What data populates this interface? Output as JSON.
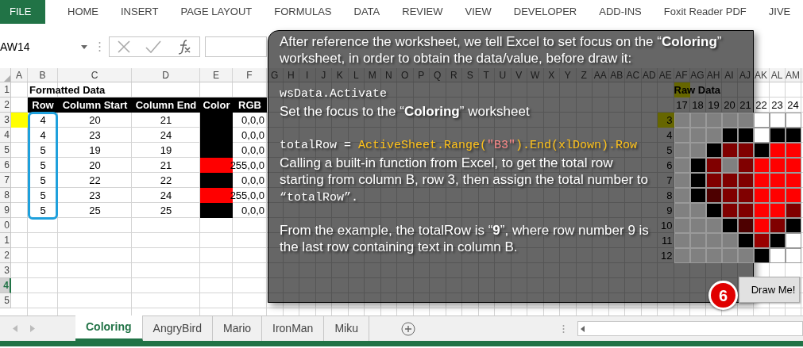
{
  "ribbon_tabs": [
    {
      "label": "FILE",
      "selected": true
    },
    {
      "label": "HOME",
      "selected": false
    },
    {
      "label": "INSERT",
      "selected": false
    },
    {
      "label": "PAGE LAYOUT",
      "selected": false
    },
    {
      "label": "FORMULAS",
      "selected": false
    },
    {
      "label": "DATA",
      "selected": false
    },
    {
      "label": "REVIEW",
      "selected": false
    },
    {
      "label": "VIEW",
      "selected": false
    },
    {
      "label": "DEVELOPER",
      "selected": false
    },
    {
      "label": "ADD-INS",
      "selected": false
    },
    {
      "label": "Foxit Reader PDF",
      "selected": false
    },
    {
      "label": "JIVE",
      "selected": false
    }
  ],
  "formula_bar": {
    "name_box": "AW14"
  },
  "column_headers": [
    "A",
    "B",
    "C",
    "D",
    "E",
    "F",
    "G",
    "H",
    "I",
    "J",
    "K",
    "L",
    "M",
    "N",
    "O",
    "P",
    "Q",
    "R",
    "S",
    "T",
    "U",
    "V",
    "W",
    "X",
    "Y",
    "Z",
    "AA",
    "AB",
    "AC",
    "AD",
    "AE",
    "AF",
    "AG",
    "AH",
    "AI",
    "AJ",
    "AK",
    "AL",
    "AM"
  ],
  "row_headers": [
    {
      "label": "1",
      "selected": false
    },
    {
      "label": "2",
      "selected": false
    },
    {
      "label": "3",
      "selected": false
    },
    {
      "label": "4",
      "selected": false
    },
    {
      "label": "5",
      "selected": false
    },
    {
      "label": "6",
      "selected": false
    },
    {
      "label": "7",
      "selected": false
    },
    {
      "label": "8",
      "selected": false
    },
    {
      "label": "9",
      "selected": false
    },
    {
      "label": "0",
      "selected": false
    },
    {
      "label": "1",
      "selected": false
    },
    {
      "label": "2",
      "selected": false
    },
    {
      "label": "3",
      "selected": false
    },
    {
      "label": "4",
      "selected": true
    },
    {
      "label": "5",
      "selected": false
    }
  ],
  "formatted_data": {
    "title": "Formatted Data",
    "columns": [
      "Row",
      "Column Start",
      "Column End",
      "Color",
      "RGB"
    ],
    "rows": [
      {
        "marked": true,
        "row": "4",
        "column_start": "20",
        "column_end": "21",
        "color": "#000000",
        "rgb": "0,0,0"
      },
      {
        "marked": false,
        "row": "4",
        "column_start": "23",
        "column_end": "24",
        "color": "#000000",
        "rgb": "0,0,0"
      },
      {
        "marked": false,
        "row": "5",
        "column_start": "19",
        "column_end": "19",
        "color": "#000000",
        "rgb": "0,0,0"
      },
      {
        "marked": false,
        "row": "5",
        "column_start": "20",
        "column_end": "21",
        "color": "#ff0000",
        "rgb": "255,0,0"
      },
      {
        "marked": false,
        "row": "5",
        "column_start": "22",
        "column_end": "22",
        "color": "#000000",
        "rgb": "0,0,0"
      },
      {
        "marked": false,
        "row": "5",
        "column_start": "23",
        "column_end": "24",
        "color": "#ff0000",
        "rgb": "255,0,0"
      },
      {
        "marked": false,
        "row": "5",
        "column_start": "25",
        "column_end": "25",
        "color": "#000000",
        "rgb": "0,0,0"
      }
    ]
  },
  "raw_data": {
    "title": "Raw Data",
    "title_marked": true,
    "column_numbers": [
      "17",
      "18",
      "19",
      "20",
      "21",
      "22",
      "23",
      "24"
    ],
    "rows": [
      {
        "label": "3",
        "marked": true,
        "cells": [
          {
            "color": "#808080"
          },
          {
            "color": "#808080"
          },
          {
            "color": "#808080"
          },
          {
            "color": "#808080"
          },
          {
            "color": "#808080"
          },
          {
            "color": "#ffffff"
          },
          {
            "color": "#ffffff"
          },
          {
            "color": "#ffffff"
          }
        ]
      },
      {
        "label": "4",
        "marked": false,
        "cells": [
          {
            "color": "#808080"
          },
          {
            "color": "#808080"
          },
          {
            "color": "#808080"
          },
          {
            "color": "#000000"
          },
          {
            "color": "#000000"
          },
          {
            "color": "#ffffff"
          },
          {
            "color": "#000000"
          },
          {
            "color": "#000000"
          }
        ]
      },
      {
        "label": "5",
        "marked": false,
        "cells": [
          {
            "color": "#808080"
          },
          {
            "color": "#808080"
          },
          {
            "color": "#000000"
          },
          {
            "color": "#800000"
          },
          {
            "color": "#800000"
          },
          {
            "color": "#000000"
          },
          {
            "color": "#ff0000"
          },
          {
            "color": "#ff0000"
          }
        ]
      },
      {
        "label": "6",
        "marked": false,
        "cells": [
          {
            "color": "#808080"
          },
          {
            "color": "#000000"
          },
          {
            "color": "#800000"
          },
          {
            "color": "#808080"
          },
          {
            "color": "#800000"
          },
          {
            "color": "#ff0000"
          },
          {
            "color": "#ff0000"
          },
          {
            "color": "#ff0000"
          }
        ]
      },
      {
        "label": "7",
        "marked": false,
        "cells": [
          {
            "color": "#808080"
          },
          {
            "color": "#000000"
          },
          {
            "color": "#800000"
          },
          {
            "color": "#800000"
          },
          {
            "color": "#800000"
          },
          {
            "color": "#ff0000"
          },
          {
            "color": "#ff0000"
          },
          {
            "color": "#ff0000"
          }
        ]
      },
      {
        "label": "8",
        "marked": false,
        "cells": [
          {
            "color": "#808080"
          },
          {
            "color": "#000000"
          },
          {
            "color": "#4d0000"
          },
          {
            "color": "#800000"
          },
          {
            "color": "#800000"
          },
          {
            "color": "#ff0000"
          },
          {
            "color": "#ff0000"
          },
          {
            "color": "#ff0000"
          }
        ]
      },
      {
        "label": "9",
        "marked": false,
        "cells": [
          {
            "color": "#808080"
          },
          {
            "color": "#808080"
          },
          {
            "color": "#000000"
          },
          {
            "color": "#800000"
          },
          {
            "color": "#800000"
          },
          {
            "color": "#ff0000"
          },
          {
            "color": "#ff0000"
          },
          {
            "color": "#800000"
          }
        ]
      },
      {
        "label": "10",
        "marked": false,
        "cells": [
          {
            "color": "#808080"
          },
          {
            "color": "#808080"
          },
          {
            "color": "#808080"
          },
          {
            "color": "#000000"
          },
          {
            "color": "#4d0000"
          },
          {
            "color": "#ff0000"
          },
          {
            "color": "#800000"
          },
          {
            "color": "#000000"
          }
        ]
      },
      {
        "label": "11",
        "marked": false,
        "cells": [
          {
            "color": "#808080"
          },
          {
            "color": "#808080"
          },
          {
            "color": "#808080"
          },
          {
            "color": "#808080"
          },
          {
            "color": "#000000"
          },
          {
            "color": "#990000"
          },
          {
            "color": "#000000"
          },
          {
            "color": "#ffffff"
          }
        ]
      },
      {
        "label": "12",
        "marked": false,
        "cells": [
          {
            "color": "#808080"
          },
          {
            "color": "#808080"
          },
          {
            "color": "#808080"
          },
          {
            "color": "#808080"
          },
          {
            "color": "#808080"
          },
          {
            "color": "#000000"
          },
          {
            "color": "#ffffff"
          },
          {
            "color": "#ffffff"
          }
        ]
      }
    ]
  },
  "draw_button": "Draw Me!",
  "callout": {
    "step": "6",
    "blocks": [
      {
        "kind": "text",
        "segments": [
          {
            "kind": "text",
            "text": "After reference the worksheet, we tell Excel to set focus on the “**Coloring**” worksheet, in order to obtain the data/value, before draw it:"
          }
        ]
      },
      {
        "kind": "code",
        "segments": [
          {
            "kind": "plain",
            "text": "wsData.Activate"
          }
        ]
      },
      {
        "kind": "text",
        "segments": [
          {
            "kind": "text",
            "text": "Set the focus to the “**Coloring**” worksheet"
          }
        ]
      },
      {
        "kind": "code",
        "segments": [
          {
            "kind": "plain",
            "text": "totalRow = "
          },
          {
            "kind": "keyword",
            "text": "ActiveSheet.Range("
          },
          {
            "kind": "string",
            "text": "\"B3\""
          },
          {
            "kind": "keyword",
            "text": ").End(xlDown).Row"
          }
        ]
      },
      {
        "kind": "text",
        "segments": [
          {
            "kind": "text",
            "text": "Calling a built-in function from Excel, to get the total row starting from column B, row 3, then assign the total number to "
          },
          {
            "kind": "plain",
            "text": "“totalRow”."
          }
        ]
      },
      {
        "kind": "text",
        "segments": [
          {
            "kind": "text",
            "text": "From the example, the totalRow is “**9**”, where row number 9 is the last row containing text in column B."
          }
        ]
      }
    ]
  },
  "sheet_tabs": [
    {
      "label": "Coloring",
      "selected": true
    },
    {
      "label": "AngryBird",
      "selected": false
    },
    {
      "label": "Mario",
      "selected": false
    },
    {
      "label": "IronMan",
      "selected": false
    },
    {
      "label": "Miku",
      "selected": false
    }
  ]
}
